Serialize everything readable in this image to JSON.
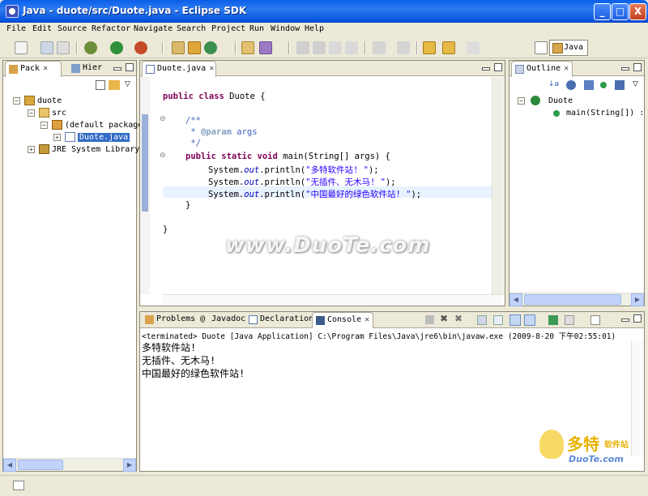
{
  "window": {
    "title": "Java - duote/src/Duote.java - Eclipse SDK",
    "controls": [
      "_",
      "□",
      "X"
    ]
  },
  "menu": [
    "File",
    "Edit",
    "Source",
    "Refactor",
    "Navigate",
    "Search",
    "Project",
    "Run",
    "Window",
    "Help"
  ],
  "perspective": "Java",
  "left_panel": {
    "tabs": [
      "Pack",
      "Hier"
    ],
    "tree": [
      {
        "label": "duote"
      },
      {
        "label": "src"
      },
      {
        "label": "(default package"
      },
      {
        "label": "Duote.java"
      },
      {
        "label": "JRE System Library"
      }
    ]
  },
  "editor": {
    "tab": "Duote.java",
    "code": {
      "l1_kw": "public class",
      "l1_rest": " Duote {",
      "l2": "/**",
      "l3_pre": " * ",
      "l3_tag": "@param",
      "l3_rest": " args",
      "l4": " */",
      "l5_kw": "public static void",
      "l5_rest": " main(String[] args) {",
      "sys": "System.",
      "out": "out",
      "println": ".println(",
      "str1": "\"多特软件站! \"",
      "str2": "\"无插件、无木马! \"",
      "str3": "\"中国最好的绿色软件站! \"",
      "end": ");",
      "close_brace": "}",
      "class_close": "}"
    }
  },
  "outline": {
    "tab": "Outline",
    "items": [
      "Duote",
      "main(String[]) :"
    ]
  },
  "bottom": {
    "tabs": [
      "Problems",
      "Javadoc",
      "Declaration",
      "Console"
    ],
    "terminated": "<terminated> Duote [Java Application] C:\\Program Files\\Java\\jre6\\bin\\javaw.exe (2009-8-20 下午02:55:01)",
    "output": [
      "多特软件站!",
      "无插件、无木马!",
      "中国最好的绿色软件站!"
    ]
  },
  "watermark": "www.DuoTe.com",
  "logo": {
    "cn": "多特",
    "cn2": "软件站",
    "en": "DuoTe.com"
  },
  "colors": {
    "keyword": "#7F0055",
    "comment": "#3F5FBF",
    "string": "#2A00FF",
    "field": "#0000C0",
    "titlebar": "#0A5FE8"
  }
}
